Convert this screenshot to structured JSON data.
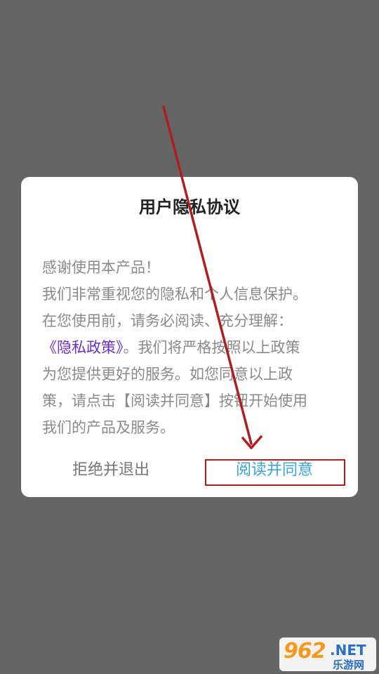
{
  "dialog": {
    "title": "用户隐私协议",
    "body": {
      "line1": "感谢使用本产品！",
      "line2": "我们非常重视您的隐私和个人信息保护。",
      "line3": "在您使用前，请务必阅读、充分理解：",
      "policy_link": "《隐私政策》",
      "line4_suffix": "。我们将严格按照以上政策",
      "line5": "为您提供更好的服务。如您同意以上政",
      "line6": "策，请点击【阅读并同意】按钮开始使用",
      "line7": "我们的产品及服务。"
    },
    "reject_label": "拒绝并退出",
    "agree_label": "阅读并同意"
  },
  "watermark": {
    "number": "962",
    "domain": ".NET",
    "site": "乐游网"
  },
  "colors": {
    "background": "#656565",
    "link": "#6b2fc9",
    "agree": "#3ba3d8",
    "annotation": "#b01f1f",
    "watermark_orange": "#f39a1d",
    "watermark_blue": "#2a6fc9"
  }
}
